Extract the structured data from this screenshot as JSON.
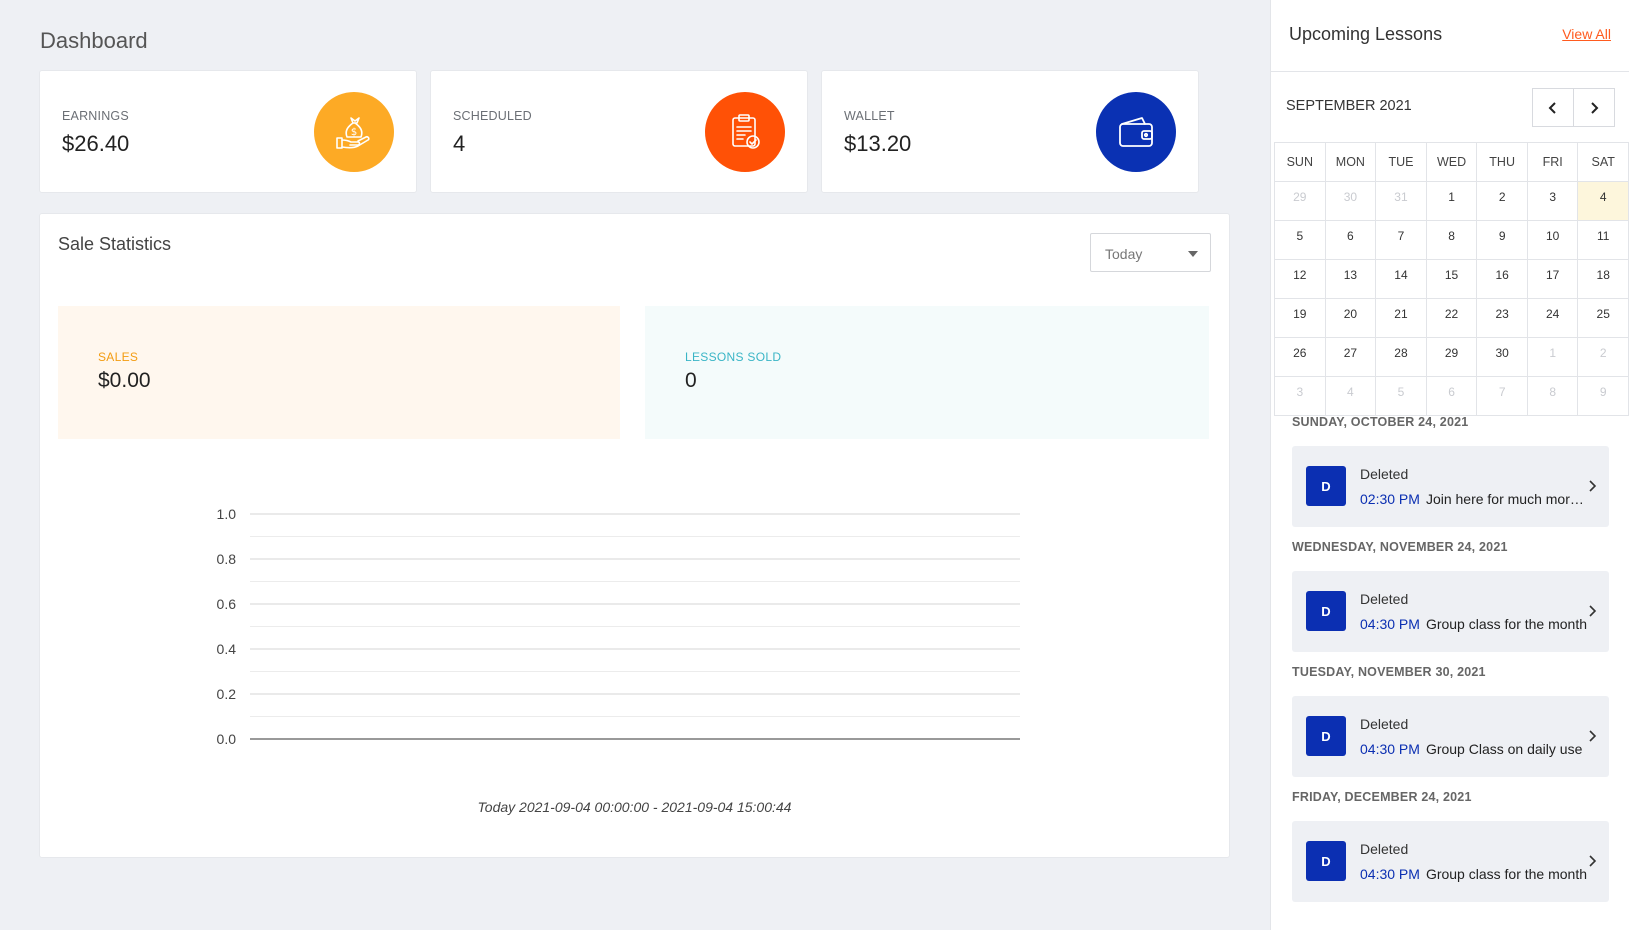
{
  "page": {
    "title": "Dashboard"
  },
  "stats": [
    {
      "label": "EARNINGS",
      "value": "$26.40",
      "icon": "money-bag-hand-icon",
      "color": "#fdaa25"
    },
    {
      "label": "SCHEDULED",
      "value": "4",
      "icon": "clipboard-check-icon",
      "color": "#ff5106"
    },
    {
      "label": "WALLET",
      "value": "$13.20",
      "icon": "wallet-icon",
      "color": "#0a31b3"
    }
  ],
  "sale": {
    "title": "Sale Statistics",
    "period": "Today",
    "sales_label": "SALES",
    "sales_value": "$0.00",
    "lessons_label": "LESSONS SOLD",
    "lessons_value": "0",
    "colors": {
      "sales_bg": "#fff7ee",
      "sales_text": "#f39c12",
      "lessons_bg": "#f4fbfb",
      "lessons_text": "#3ab5c6"
    }
  },
  "chart_data": {
    "type": "line",
    "title": "",
    "xlabel": "Today 2021-09-04 00:00:00 - 2021-09-04 15:00:44",
    "ylabel": "",
    "ylim": [
      0,
      1
    ],
    "yticks": [
      "1.0",
      "0.8",
      "0.6",
      "0.4",
      "0.2",
      "0.0"
    ],
    "series": [],
    "grid": true
  },
  "side": {
    "title": "Upcoming Lessons",
    "view_all": "View All",
    "calendar": {
      "month": "SEPTEMBER 2021",
      "weekdays": [
        "SUN",
        "MON",
        "TUE",
        "WED",
        "THU",
        "FRI",
        "SAT"
      ],
      "weeks": [
        [
          "29",
          "30",
          "31",
          "1",
          "2",
          "3",
          "4"
        ],
        [
          "5",
          "6",
          "7",
          "8",
          "9",
          "10",
          "11"
        ],
        [
          "12",
          "13",
          "14",
          "15",
          "16",
          "17",
          "18"
        ],
        [
          "19",
          "20",
          "21",
          "22",
          "23",
          "24",
          "25"
        ],
        [
          "26",
          "27",
          "28",
          "29",
          "30",
          "1",
          "2"
        ],
        [
          "3",
          "4",
          "5",
          "6",
          "7",
          "8",
          "9"
        ]
      ],
      "selected_day": "4"
    },
    "lessons": [
      {
        "date": "SUNDAY, OCTOBER 24, 2021",
        "avatar": "D",
        "status": "Deleted",
        "time": "02:30 PM",
        "text": "Join here for much more fun"
      },
      {
        "date": "WEDNESDAY, NOVEMBER 24, 2021",
        "avatar": "D",
        "status": "Deleted",
        "time": "04:30 PM",
        "text": "Group class for the month"
      },
      {
        "date": "TUESDAY, NOVEMBER 30, 2021",
        "avatar": "D",
        "status": "Deleted",
        "time": "04:30 PM",
        "text": "Group Class on daily use"
      },
      {
        "date": "FRIDAY, DECEMBER 24, 2021",
        "avatar": "D",
        "status": "Deleted",
        "time": "04:30 PM",
        "text": "Group class for the month"
      }
    ]
  }
}
